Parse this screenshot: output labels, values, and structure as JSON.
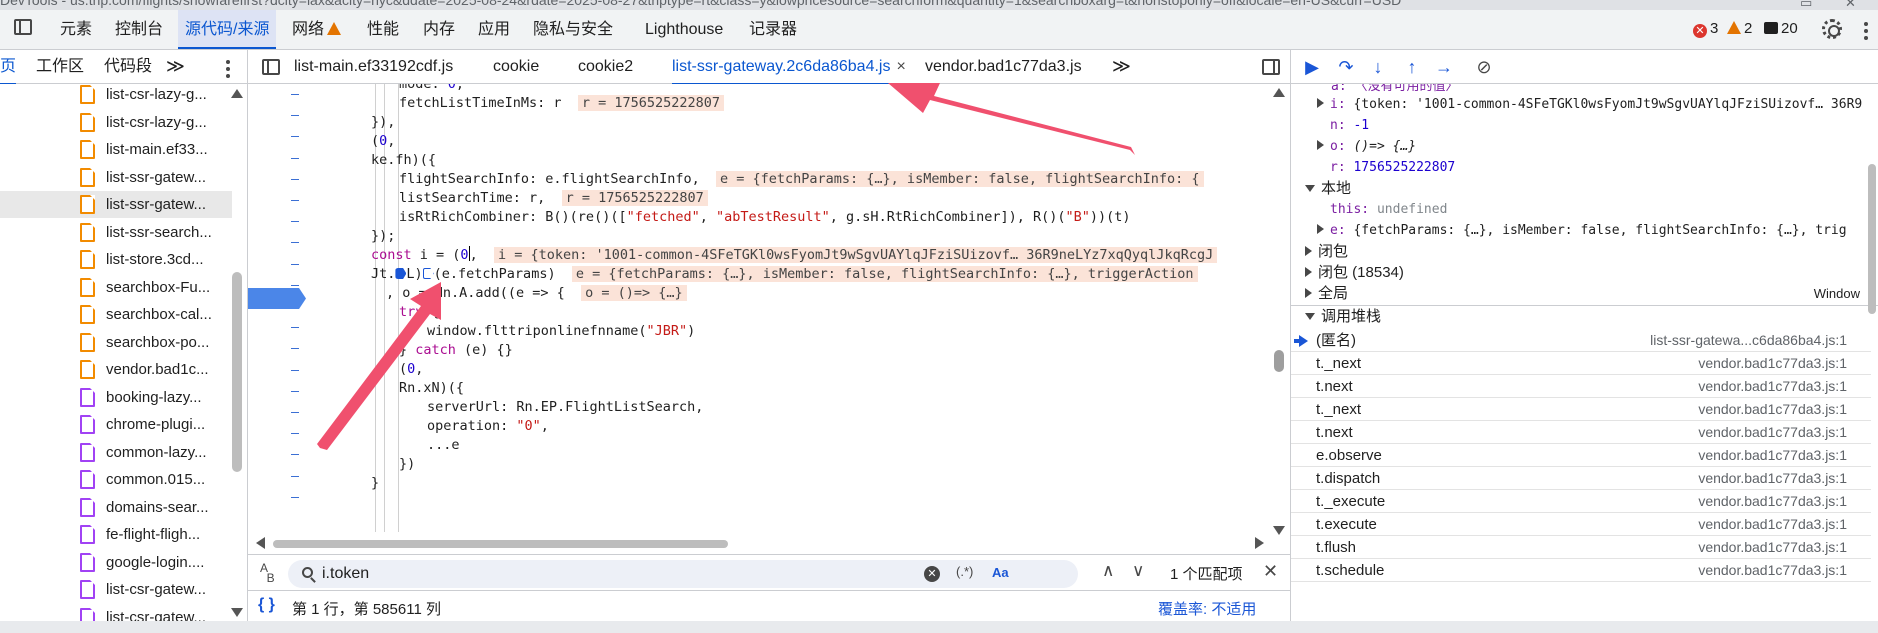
{
  "window": {
    "title": "DevTools - us.trip.com/flights/showfarefirst?dcity=lax&acity=nyc&ddate=2025-08-24&rdate=2025-08-27&triptype=rt&class=y&lowpricesource=searchform&quantity=1&searchboxarg=t&nonstoponly=off&locale=en-US&curr=USD"
  },
  "top_tabs": [
    {
      "label": "元素"
    },
    {
      "label": "控制台"
    },
    {
      "label": "源代码/来源"
    },
    {
      "label": "网络"
    },
    {
      "label": "性能"
    },
    {
      "label": "内存"
    },
    {
      "label": "应用"
    },
    {
      "label": "隐私与安全"
    },
    {
      "label": "Lighthouse"
    },
    {
      "label": "记录器"
    }
  ],
  "badges": {
    "errors": "3",
    "warnings": "2",
    "messages": "20",
    "error_color": "#dc362e",
    "warning_color": "#e37400"
  },
  "nav_tabs": [
    {
      "label": "页"
    },
    {
      "label": "工作区"
    },
    {
      "label": "代码段"
    },
    {
      "label": "≫"
    }
  ],
  "files": [
    {
      "name": "list-csr-lazy-g...",
      "color": "orange"
    },
    {
      "name": "list-csr-lazy-g...",
      "color": "orange"
    },
    {
      "name": "list-main.ef33...",
      "color": "orange"
    },
    {
      "name": "list-ssr-gatew...",
      "color": "orange"
    },
    {
      "name": "list-ssr-gatew...",
      "color": "orange",
      "selected": true
    },
    {
      "name": "list-ssr-search...",
      "color": "orange"
    },
    {
      "name": "list-store.3cd...",
      "color": "orange"
    },
    {
      "name": "searchbox-Fu...",
      "color": "orange"
    },
    {
      "name": "searchbox-cal...",
      "color": "orange"
    },
    {
      "name": "searchbox-po...",
      "color": "orange"
    },
    {
      "name": "vendor.bad1c...",
      "color": "orange"
    },
    {
      "name": "booking-lazy...",
      "color": "purple"
    },
    {
      "name": "chrome-plugi...",
      "color": "purple"
    },
    {
      "name": "common-lazy...",
      "color": "purple"
    },
    {
      "name": "common.015...",
      "color": "purple"
    },
    {
      "name": "domains-sear...",
      "color": "purple"
    },
    {
      "name": "fe-flight-fligh...",
      "color": "purple"
    },
    {
      "name": "google-login....",
      "color": "purple"
    },
    {
      "name": "list-csr-gatew...",
      "color": "purple"
    },
    {
      "name": "list-csr-gatew...",
      "color": "purple"
    }
  ],
  "editor_tabs": [
    {
      "label": "list-main.ef33192cdf.js"
    },
    {
      "label": "cookie"
    },
    {
      "label": "cookie2"
    },
    {
      "label": "list-ssr-gateway.2c6da86ba4.js",
      "close": "×"
    },
    {
      "label": "vendor.bad1c77da3.js"
    },
    {
      "label": "≫"
    }
  ],
  "code": {
    "l0": "mode: ",
    "l0n": "0",
    "l1": "fetchListTimeInMs: r",
    "l1h": "r = 1756525222807",
    "l2": "}),",
    "l3a": "(",
    "l3n": "0",
    "l3b": ",",
    "l4": "ke.fh)({",
    "l5": "flightSearchInfo: e.flightSearchInfo,",
    "l5h": "e = {fetchParams: {…}, isMember: false, flightSearchInfo: {",
    "l6": "listSearchTime: r,",
    "l6h": "r = 1756525222807",
    "l7a": "isRtRichCombiner: B()(re()([",
    "l7s1": "\"fetched\"",
    "l7b": ", ",
    "l7s2": "\"abTestResult\"",
    "l7c": ", g.sH.RtRichCombiner]), R()(",
    "l7s3": "\"B\"",
    "l7d": "))(t)",
    "l8": "});",
    "l9k": "const",
    "l9a": " i = (",
    "l9n": "0",
    "l9b": ",",
    "l9h": "i = {token: '1001-common-4SFeTGKl0wsFyomJt9wSgvUAYlqJFziSUizovf… 36R9neLYz7xqQyqlJkqRcgJ",
    "l10a": "Jt.",
    "l10b": "L)",
    "l10c": "(e.fetchParams)",
    "l10h": "e = {fetchParams: {…}, isMember: false, flightSearchInfo: {…}, triggerAction",
    "l11": ", o = Nn.A.add((e => {",
    "l11h": "o = ()=> {…}",
    "l12k": "try",
    "l12": " {",
    "l13a": "window.flttriponlinefnname(",
    "l13s": "\"JBR\"",
    "l13b": ")",
    "l14a": "} ",
    "l14k": "catch",
    "l14b": " (e) {}",
    "l15a": "(",
    "l15n": "0",
    "l15b": ",",
    "l16": "Rn.xN)({",
    "l17": "serverUrl: Rn.EP.FlightListSearch,",
    "l18a": "operation: ",
    "l18s": "\"0\"",
    "l18b": ",",
    "l19": "...e",
    "l20": "})",
    "l21": "}"
  },
  "search": {
    "value": "i.token",
    "regex": "(.*)",
    "case": "Aa",
    "result": "1 个匹配项",
    "up": "∧",
    "down": "∨",
    "close": "✕"
  },
  "status": {
    "braces": "{ }",
    "position": "第 1 行，第 585611 列",
    "coverage": "覆盖率: 不适用"
  },
  "scope": {
    "top_line": "a: 〈没有可用的值〉",
    "i_key": "i:",
    "i_val": "{token: '1001-common-4SFeTGKl0wsFyomJt9wSgvUAYlqJFziSUizovf… 36R9",
    "n_key": "n:",
    "n_val": "-1",
    "o_key": "o:",
    "o_val": "()=> {…}",
    "r_key": "r:",
    "r_val": "1756525222807",
    "local": "本地",
    "this_key": "this:",
    "this_val": "undefined",
    "e_key": "e:",
    "e_val": "{fetchParams: {…}, isMember: false, flightSearchInfo: {…}, trig",
    "closure1": "闭包",
    "closure2": "闭包 (18534)",
    "global": "全局",
    "global_val": "Window",
    "callstack": "调用堆栈"
  },
  "frames": [
    {
      "fn": "(匿名)",
      "loc": "list-ssr-gatewa...c6da86ba4.js:1",
      "current": true
    },
    {
      "fn": "t._next",
      "loc": "vendor.bad1c77da3.js:1"
    },
    {
      "fn": "t.next",
      "loc": "vendor.bad1c77da3.js:1"
    },
    {
      "fn": "t._next",
      "loc": "vendor.bad1c77da3.js:1"
    },
    {
      "fn": "t.next",
      "loc": "vendor.bad1c77da3.js:1"
    },
    {
      "fn": "e.observe",
      "loc": "vendor.bad1c77da3.js:1"
    },
    {
      "fn": "t.dispatch",
      "loc": "vendor.bad1c77da3.js:1"
    },
    {
      "fn": "t._execute",
      "loc": "vendor.bad1c77da3.js:1"
    },
    {
      "fn": "t.execute",
      "loc": "vendor.bad1c77da3.js:1"
    },
    {
      "fn": "t.flush",
      "loc": "vendor.bad1c77da3.js:1"
    },
    {
      "fn": "t.schedule",
      "loc": "vendor.bad1c77da3.js:1"
    }
  ],
  "annotation_color": "#f0506e"
}
